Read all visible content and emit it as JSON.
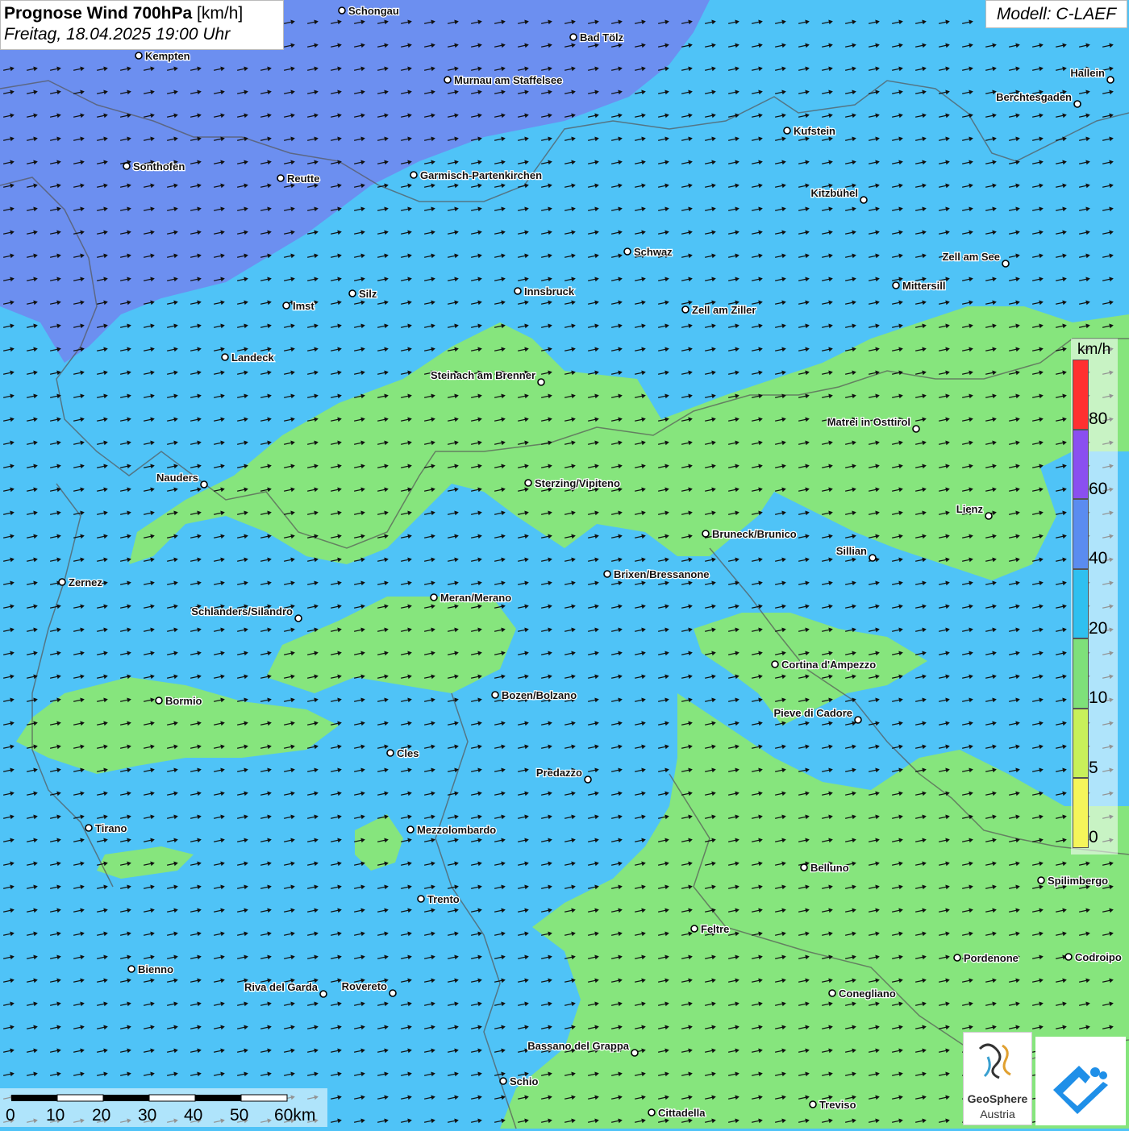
{
  "title": {
    "bold": "Prognose Wind 700hPa",
    "unit": "[km/h]",
    "datetime": "Freitag, 18.04.2025 19:00 Uhr"
  },
  "model": "Modell: C-LAEF",
  "legend": {
    "unit": "km/h",
    "steps": [
      {
        "label": "80",
        "color": "#ff3030"
      },
      {
        "label": "60",
        "color": "#8a4ff0"
      },
      {
        "label": "40",
        "color": "#5a8cf0"
      },
      {
        "label": "20",
        "color": "#2fc0f0"
      },
      {
        "label": "10",
        "color": "#7ee07a"
      },
      {
        "label": "5",
        "color": "#c8f05a"
      },
      {
        "label": "0",
        "color": "#f5f55a"
      }
    ]
  },
  "scale": {
    "labels": [
      "0",
      "10",
      "20",
      "30",
      "40",
      "50",
      "60km"
    ]
  },
  "logos": {
    "geosphere_line1": "GeoSphere",
    "geosphere_line2": "Austria"
  },
  "cities": [
    {
      "name": "Schongau"
    },
    {
      "name": "Bad Tölz"
    },
    {
      "name": "Kempten"
    },
    {
      "name": "Murnau am Staffelsee"
    },
    {
      "name": "Hallein"
    },
    {
      "name": "Berchtesgaden"
    },
    {
      "name": "Kufstein"
    },
    {
      "name": "Sonthofen"
    },
    {
      "name": "Reutte"
    },
    {
      "name": "Garmisch-Partenkirchen"
    },
    {
      "name": "Kitzbühel"
    },
    {
      "name": "Schwaz"
    },
    {
      "name": "Zell am See"
    },
    {
      "name": "Mittersill"
    },
    {
      "name": "Imst"
    },
    {
      "name": "Silz"
    },
    {
      "name": "Innsbruck"
    },
    {
      "name": "Zell am Ziller"
    },
    {
      "name": "Landeck"
    },
    {
      "name": "Steinach am Brenner"
    },
    {
      "name": "Matrei in Osttirol"
    },
    {
      "name": "Nauders"
    },
    {
      "name": "Sterzing/Vipiteno"
    },
    {
      "name": "Lienz"
    },
    {
      "name": "Bruneck/Brunico"
    },
    {
      "name": "Sillian"
    },
    {
      "name": "Zernez"
    },
    {
      "name": "Brixen/Bressanone"
    },
    {
      "name": "Meran/Merano"
    },
    {
      "name": "Schlanders/Silandro"
    },
    {
      "name": "Cortina d'Ampezzo"
    },
    {
      "name": "Bozen/Bolzano"
    },
    {
      "name": "Bormio"
    },
    {
      "name": "Pieve di Cadore"
    },
    {
      "name": "Cles"
    },
    {
      "name": "Predazzo"
    },
    {
      "name": "Tirano"
    },
    {
      "name": "Mezzolombardo"
    },
    {
      "name": "Belluno"
    },
    {
      "name": "Spilimbergo"
    },
    {
      "name": "Trento"
    },
    {
      "name": "Feltre"
    },
    {
      "name": "Pordenone"
    },
    {
      "name": "Codroipo"
    },
    {
      "name": "Bienno"
    },
    {
      "name": "Riva del Garda"
    },
    {
      "name": "Rovereto"
    },
    {
      "name": "Conegliano"
    },
    {
      "name": "Bassano del Grappa"
    },
    {
      "name": "Schio"
    },
    {
      "name": "Treviso"
    },
    {
      "name": "Cittadella"
    }
  ]
}
